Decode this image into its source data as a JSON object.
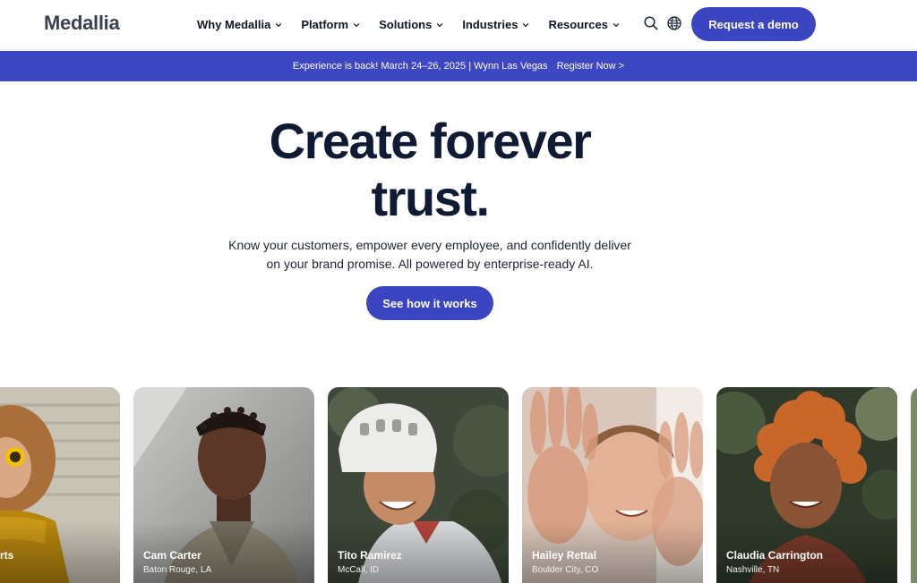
{
  "header": {
    "logo": "Medallia",
    "nav": [
      {
        "label": "Why Medallia"
      },
      {
        "label": "Platform"
      },
      {
        "label": "Solutions"
      },
      {
        "label": "Industries"
      },
      {
        "label": "Resources"
      }
    ],
    "demo_button": "Request a demo",
    "icons": [
      "search-icon",
      "globe-icon",
      "chevron-down-icon"
    ]
  },
  "banner": {
    "text": "Experience is back! March 24–26, 2025 | Wynn Las Vegas",
    "link": "Register Now >"
  },
  "hero": {
    "title_line1": "Create forever",
    "title_line2": "trust.",
    "subtitle_line1": "Know your customers, empower every employee, and confidently deliver",
    "subtitle_line2": "on your brand promise. All powered by enterprise-ready AI.",
    "cta": "See how it works"
  },
  "cards": [
    {
      "name": "rts",
      "location": ""
    },
    {
      "name": "Cam Carter",
      "location": "Baton Rouge, LA"
    },
    {
      "name": "Tito Ramirez",
      "location": "McCall, ID"
    },
    {
      "name": "Hailey Rettal",
      "location": "Boulder City, CO"
    },
    {
      "name": "Claudia Carrington",
      "location": "Nashville, TN"
    }
  ],
  "colors": {
    "brand": "#3b44c1",
    "banner": "#3d46c3",
    "title": "#0f1b33"
  }
}
